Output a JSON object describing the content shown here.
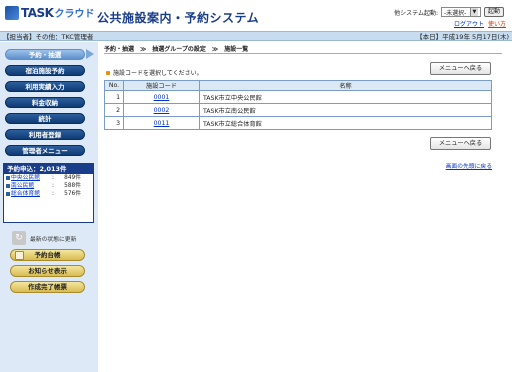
{
  "header": {
    "logo_task": "TASK",
    "logo_cloud": "クラウド",
    "title": "公共施設案内・予約システム",
    "sys_label": "他システム起動:",
    "sys_select": "-未選択-",
    "sys_button": "起動",
    "logout": "ログアウト",
    "help": "使い方"
  },
  "infobar": {
    "user": "【担当者】その他：TKC管理者",
    "date": "【本日】平成19年 5月17日(木)"
  },
  "sidebar": {
    "menu": [
      {
        "label": "予約・抽選",
        "active": true
      },
      {
        "label": "宿泊施設予約"
      },
      {
        "label": "利用実績入力"
      },
      {
        "label": "料金収納"
      },
      {
        "label": "統計"
      },
      {
        "label": "利用者登録"
      },
      {
        "label": "管理者メニュー"
      }
    ],
    "stats_title": "予約申込：2,013件",
    "stats": [
      {
        "name": "中央公民館",
        "sep": ":",
        "count": "849件"
      },
      {
        "name": "南公民館",
        "sep": ":",
        "count": "588件"
      },
      {
        "name": "総合体育館",
        "sep": ":",
        "count": "576件"
      }
    ],
    "refresh": "最新の状態に更新",
    "buttons": [
      "予約台帳",
      "お知らせ表示",
      "作成完了帳票"
    ]
  },
  "main": {
    "breadcrumb": "予約・抽選　≫　抽選グループの設定　≫　施設一覧",
    "instruction": "施設コードを選択してください。",
    "back_button": "メニューへ戻る",
    "columns": [
      "No.",
      "施設コード",
      "名称"
    ],
    "rows": [
      {
        "no": "1",
        "code": "0001",
        "name": "TASK市立中央公民館"
      },
      {
        "no": "2",
        "code": "0002",
        "name": "TASK市立南公民館"
      },
      {
        "no": "3",
        "code": "0011",
        "name": "TASK市立総合体育館"
      }
    ],
    "top_link": "画面の先頭に戻る"
  }
}
